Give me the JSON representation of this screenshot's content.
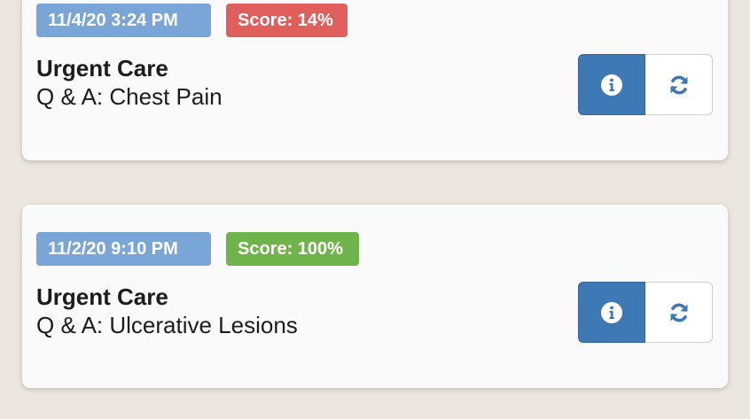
{
  "colors": {
    "background": "#ebe6df",
    "card": "#fafafa",
    "date_badge": "#79a6d6",
    "score_low": "#de5f5c",
    "score_high": "#6fb44a",
    "info_button": "#3e78b5",
    "icon_blue": "#3e78b5"
  },
  "results": [
    {
      "date": "11/4/20 3:24 PM",
      "score": "Score: 14%",
      "score_status": "low",
      "category": "Urgent Care",
      "topic": "Q & A: Chest Pain",
      "info_icon": "info-icon",
      "retry_icon": "refresh-icon"
    },
    {
      "date": "11/2/20 9:10 PM",
      "score": "Score: 100%",
      "score_status": "high",
      "category": "Urgent Care",
      "topic": "Q & A: Ulcerative Lesions",
      "info_icon": "info-icon",
      "retry_icon": "refresh-icon"
    }
  ]
}
